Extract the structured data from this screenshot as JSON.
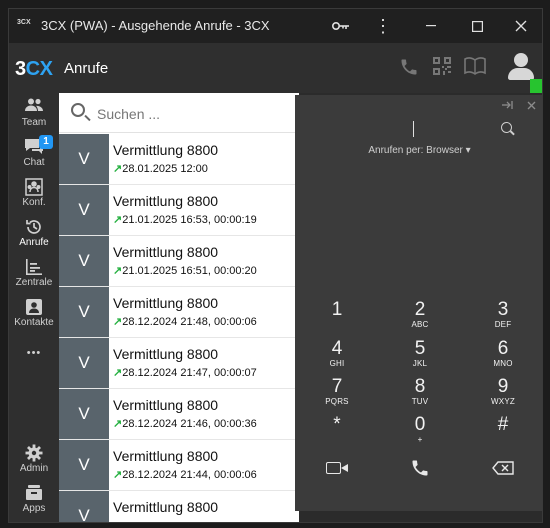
{
  "window": {
    "title": "3CX (PWA) - Ausgehende Anrufe - 3CX",
    "logo_small": "3CX"
  },
  "header": {
    "brand_main": "3",
    "brand_accent": "CX",
    "title": "Anrufe"
  },
  "sidebar": {
    "items": [
      {
        "label": "Team",
        "icon": "team-icon"
      },
      {
        "label": "Chat",
        "icon": "chat-icon",
        "badge": "1"
      },
      {
        "label": "Konf.",
        "icon": "conference-icon"
      },
      {
        "label": "Anrufe",
        "icon": "history-icon"
      },
      {
        "label": "Zentrale",
        "icon": "switchboard-icon"
      },
      {
        "label": "Kontakte",
        "icon": "contacts-icon"
      },
      {
        "label": "•••",
        "icon": "more-icon"
      },
      {
        "label": "Admin",
        "icon": "gear-icon"
      },
      {
        "label": "Apps",
        "icon": "apps-icon"
      }
    ]
  },
  "search": {
    "placeholder": "Suchen ..."
  },
  "calls": [
    {
      "initial": "V",
      "name": "Vermittlung 8800",
      "meta": "28.01.2025 12:00"
    },
    {
      "initial": "V",
      "name": "Vermittlung 8800",
      "meta": "21.01.2025 16:53, 00:00:19"
    },
    {
      "initial": "V",
      "name": "Vermittlung 8800",
      "meta": "21.01.2025 16:51, 00:00:20"
    },
    {
      "initial": "V",
      "name": "Vermittlung 8800",
      "meta": "28.12.2024 21:48, 00:00:06"
    },
    {
      "initial": "V",
      "name": "Vermittlung 8800",
      "meta": "28.12.2024 21:47, 00:00:07"
    },
    {
      "initial": "V",
      "name": "Vermittlung 8800",
      "meta": "28.12.2024 21:46, 00:00:36"
    },
    {
      "initial": "V",
      "name": "Vermittlung 8800",
      "meta": "28.12.2024 21:44, 00:00:06"
    },
    {
      "initial": "V",
      "name": "Vermittlung 8800",
      "meta": ""
    }
  ],
  "dialer": {
    "call_via": "Anrufen per: Browser ▾",
    "keys": [
      {
        "digit": "1",
        "letters": ""
      },
      {
        "digit": "2",
        "letters": "ABC"
      },
      {
        "digit": "3",
        "letters": "DEF"
      },
      {
        "digit": "4",
        "letters": "GHI"
      },
      {
        "digit": "5",
        "letters": "JKL"
      },
      {
        "digit": "6",
        "letters": "MNO"
      },
      {
        "digit": "7",
        "letters": "PQRS"
      },
      {
        "digit": "8",
        "letters": "TUV"
      },
      {
        "digit": "9",
        "letters": "WXYZ"
      },
      {
        "digit": "*",
        "letters": ""
      },
      {
        "digit": "0",
        "letters": "+"
      },
      {
        "digit": "#",
        "letters": ""
      }
    ]
  },
  "colors": {
    "accent": "#2ea3f2",
    "status": "#27c42f",
    "outgoing_arrow": "#25b040",
    "avatar_bg": "#59646c"
  }
}
